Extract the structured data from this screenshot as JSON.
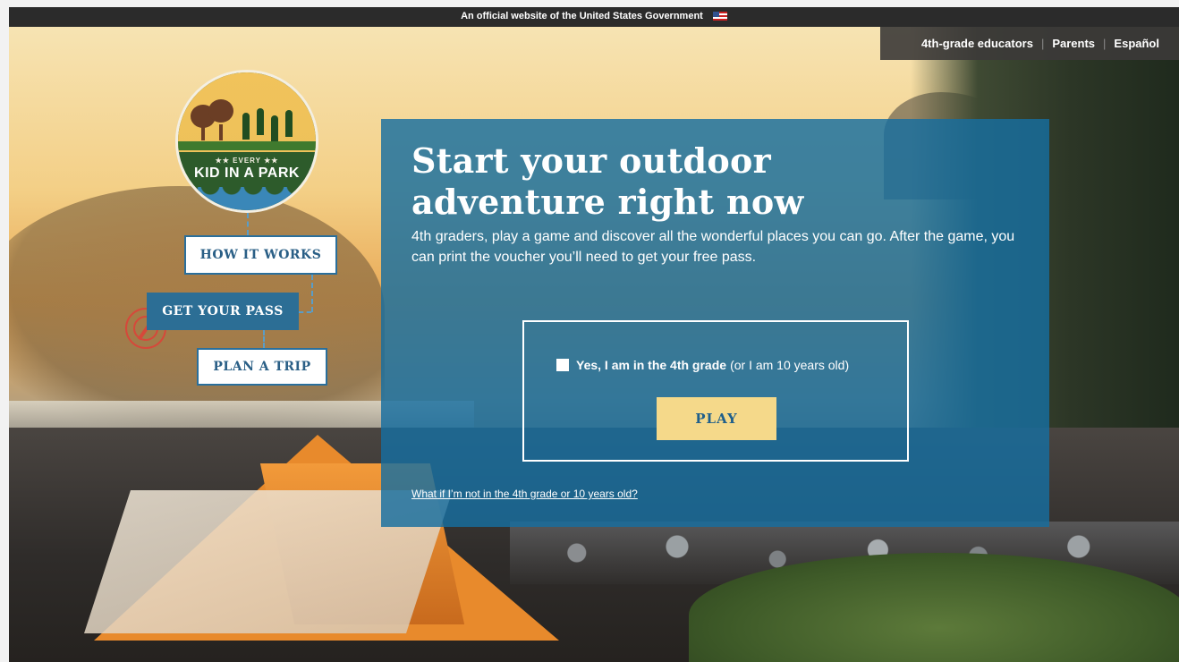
{
  "gov_banner": {
    "text": "An official website of the United States Government",
    "flag_icon": "us-flag-icon"
  },
  "top_nav": {
    "items": [
      {
        "label": "4th-grade educators"
      },
      {
        "label": "Parents"
      },
      {
        "label": "Español"
      }
    ],
    "separator": "|"
  },
  "logo": {
    "stars_text": "★★ EVERY ★★",
    "title": "KID IN A PARK"
  },
  "side_nav": {
    "how_it_works": "HOW IT WORKS",
    "get_your_pass": "GET YOUR PASS",
    "plan_a_trip": "PLAN A TRIP"
  },
  "hero": {
    "headline": "Start your outdoor adventure right now",
    "intro": "4th graders, play a game and discover all the wonderful places you can go. After the game, you can print the voucher you’ll need to get your free pass.",
    "checkbox_label_strong": "Yes, I am in the 4th grade",
    "checkbox_label_normal": "(or I am 10 years old)",
    "checkbox_checked": false,
    "play_button": "PLAY",
    "not_eligible_link": "What if I’m not in the 4th grade or 10 years old?"
  },
  "colors": {
    "panel": "#166ea0",
    "play_button": "#f5d98a",
    "nav_button_border": "#2a6f9c",
    "gov_banner": "#2b2b2b"
  }
}
